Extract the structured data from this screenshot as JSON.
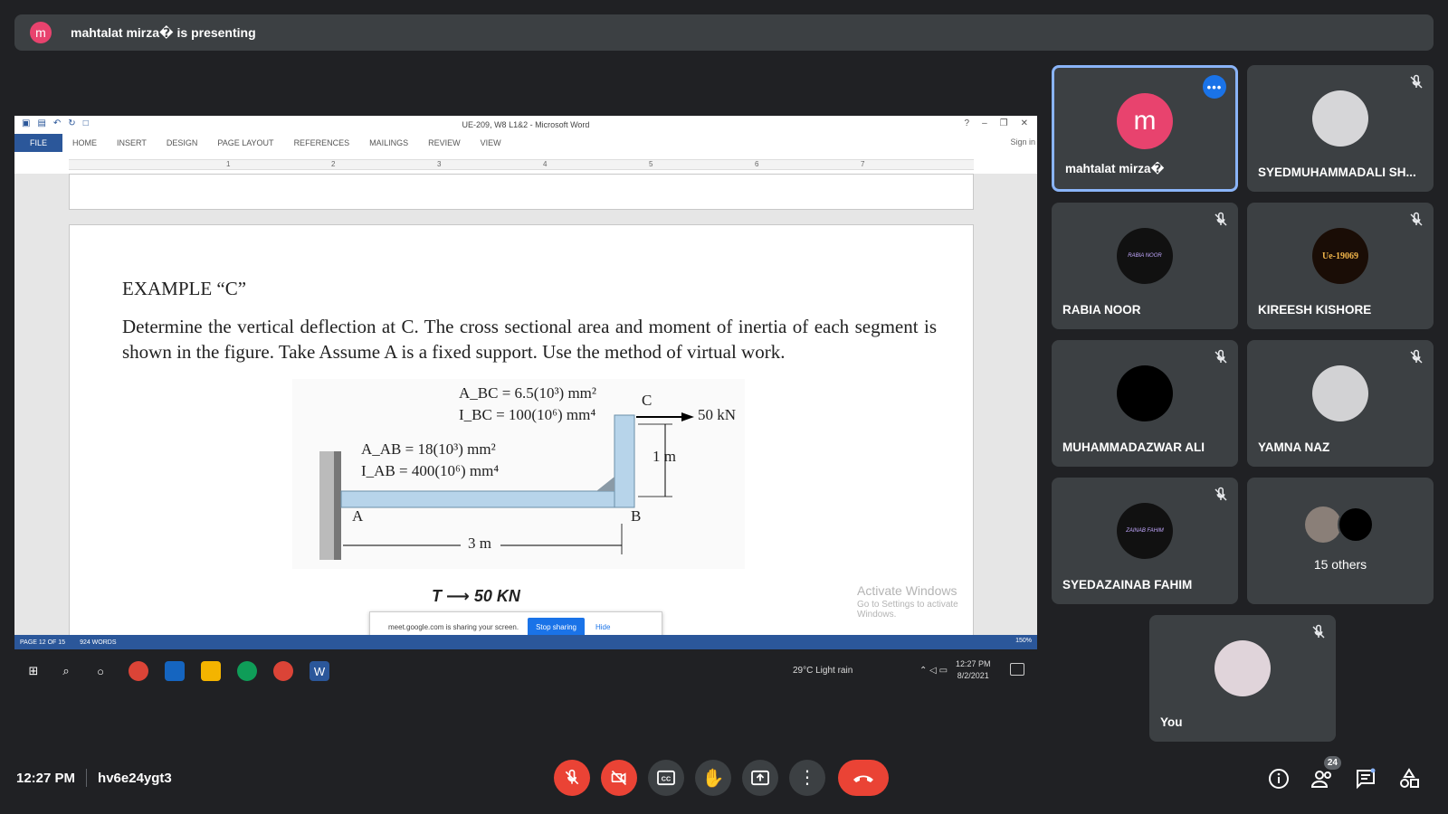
{
  "presenter_bar": {
    "avatar_letter": "m",
    "text": "mahtalat mirza� is presenting"
  },
  "shared_screen": {
    "word": {
      "title": "UE-209, W8 L1&2 - Microsoft Word",
      "tabs": [
        "FILE",
        "HOME",
        "INSERT",
        "DESIGN",
        "PAGE LAYOUT",
        "REFERENCES",
        "MAILINGS",
        "REVIEW",
        "VIEW"
      ],
      "sign_in": "Sign in",
      "ruler_numbers": [
        "1",
        "2",
        "3",
        "4",
        "5",
        "6",
        "7"
      ],
      "status_page": "PAGE 12 OF 15",
      "status_words": "924 WORDS",
      "zoom": "150%"
    },
    "document": {
      "example_title": "EXAMPLE “C”",
      "body": "Determine the vertical deflection at C. The cross sectional area and moment of inertia of each segment is shown in the figure. Take Assume A is a fixed support. Use the method of virtual work.",
      "figure": {
        "a_bc": "A_BC = 6.5(10³) mm²",
        "i_bc": "I_BC = 100(10⁶) mm⁴",
        "a_ab": "A_AB = 18(10³) mm²",
        "i_ab": "I_AB = 400(10⁶) mm⁴",
        "label_c": "C",
        "label_a": "A",
        "label_b": "B",
        "load": "50 kN",
        "height": "1 m",
        "length": "3 m"
      },
      "handwriting": "50 KN"
    },
    "activate_windows": {
      "line1": "Activate Windows",
      "line2": "Go to Settings to activate Windows."
    },
    "share_banner": {
      "text": "meet.google.com is sharing your screen.",
      "stop": "Stop sharing",
      "hide": "Hide"
    },
    "taskbar": {
      "weather": "29°C  Light rain",
      "time": "12:27 PM",
      "date": "8/2/2021"
    }
  },
  "participants": [
    {
      "name": "mahtalat mirza�",
      "avatar_letter": "m",
      "avatar_color": "#e8436e",
      "active": true
    },
    {
      "name": "SYEDMUHAMMADALI SH...",
      "muted": true
    },
    {
      "name": "RABIA NOOR",
      "avatar_text": "RABIA NOOR",
      "muted": true
    },
    {
      "name": "KIREESH KISHORE",
      "avatar_text": "Ue-19069",
      "muted": true
    },
    {
      "name": "MUHAMMADAZWAR ALI",
      "muted": true
    },
    {
      "name": "YAMNA NAZ",
      "muted": true
    },
    {
      "name": "SYEDAZAINAB FAHIM",
      "avatar_text": "ZAINAB FAHIM",
      "muted": true
    },
    {
      "name": "15 others"
    },
    {
      "name": "You",
      "muted": true
    }
  ],
  "bottom_bar": {
    "time": "12:27 PM",
    "meeting_code": "hv6e24ygt3",
    "participant_count": "24"
  },
  "colors": {
    "background": "#202124",
    "tile": "#3c4043",
    "accent": "#8ab4f8",
    "danger": "#ea4335",
    "word_blue": "#2b579a"
  }
}
